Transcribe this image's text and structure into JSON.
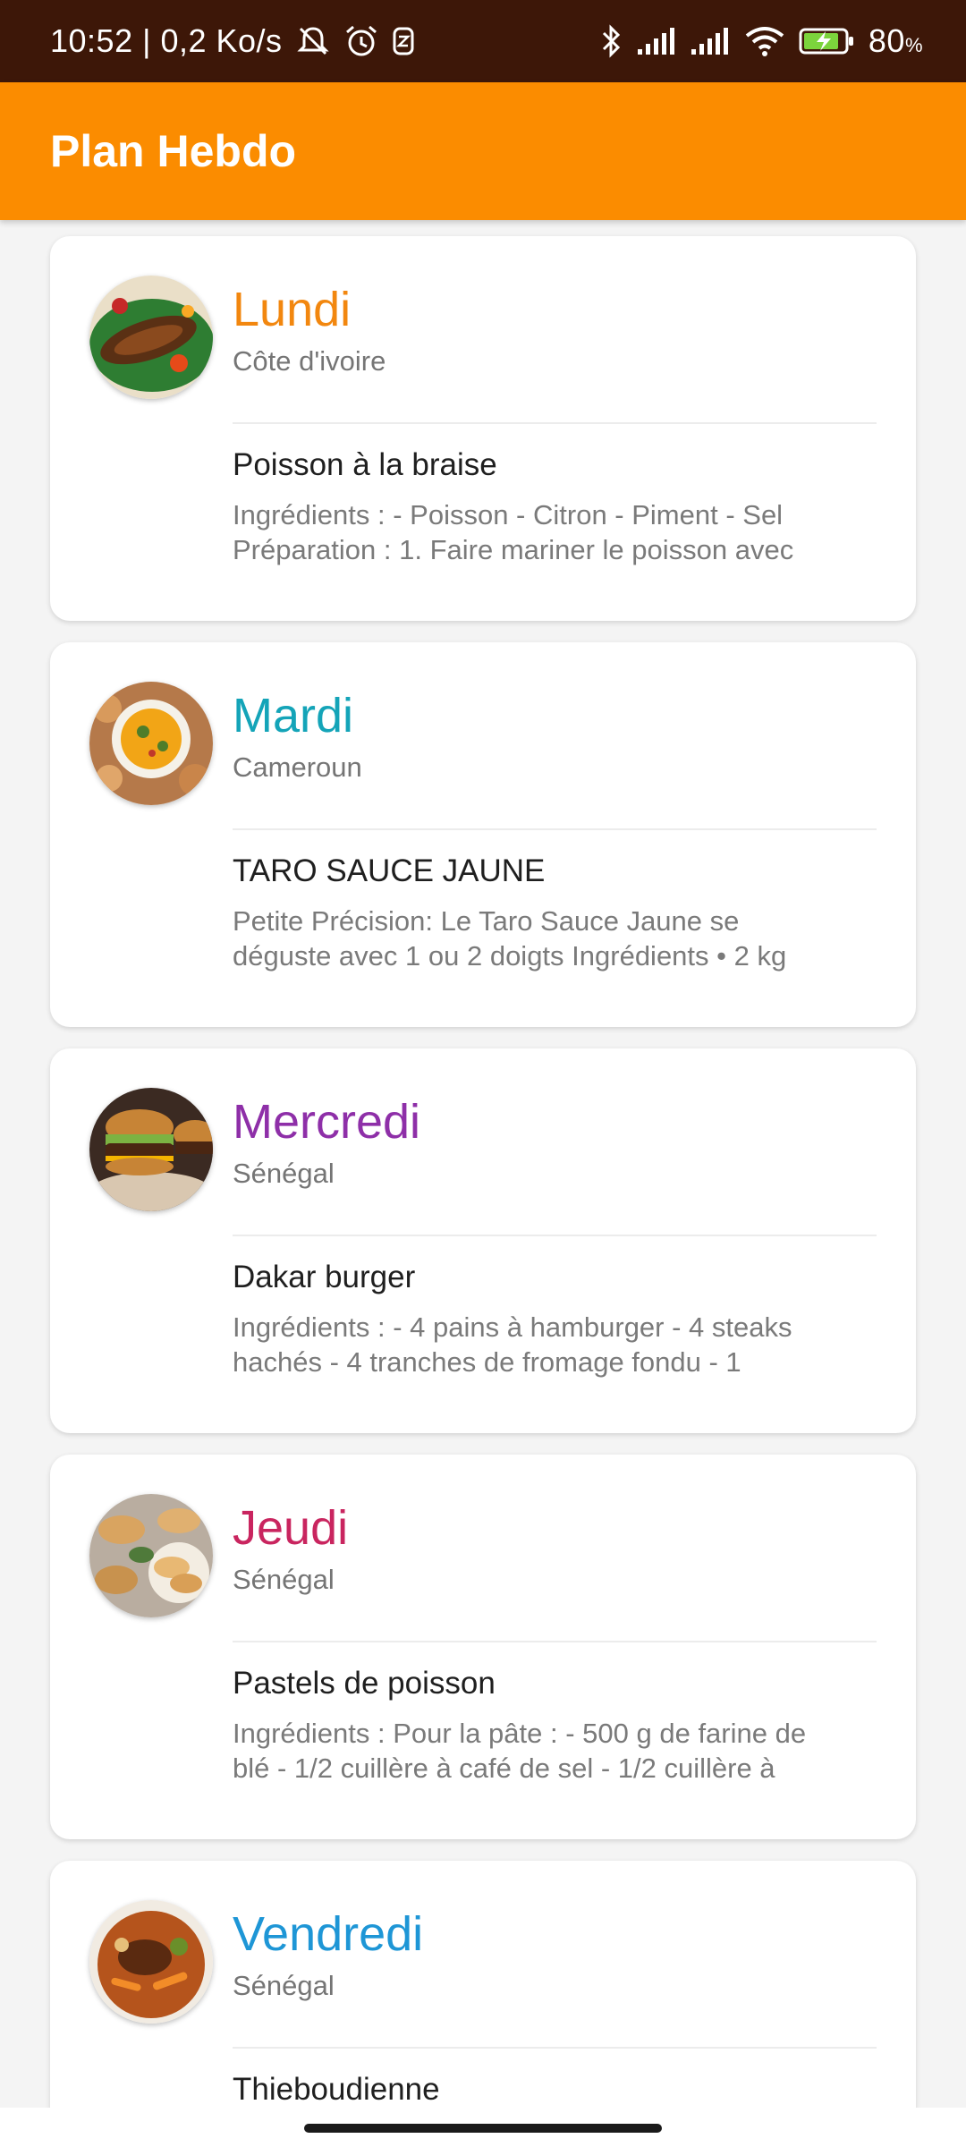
{
  "status_bar": {
    "time_speed": "10:52 | 0,2 Ko/s",
    "battery": "80",
    "battery_unit": "%",
    "icons": [
      "muted-notifications-icon",
      "alarm-icon",
      "app-notification-icon",
      "bluetooth-icon",
      "signal-icon",
      "signal-icon",
      "wifi-icon",
      "battery-charging-icon"
    ]
  },
  "app_bar": {
    "title": "Plan Hebdo",
    "color": "#fb8c00"
  },
  "days": [
    {
      "day": "Lundi",
      "day_color": "#f2870f",
      "country": "Côte d'ivoire",
      "dish": "Poisson à la braise",
      "desc_lines": [
        "Ingrédients : - Poisson - Citron - Piment - Sel",
        "Préparation : 1. Faire mariner le poisson avec"
      ],
      "image": "grilled-fish-image"
    },
    {
      "day": "Mardi",
      "day_color": "#14a4b8",
      "country": "Cameroun",
      "dish": "TARO SAUCE JAUNE",
      "desc_lines": [
        "Petite Précision: Le Taro Sauce Jaune se",
        "déguste avec 1 ou 2 doigts  Ingrédients   • 2 kg"
      ],
      "image": "taro-yellow-sauce-image"
    },
    {
      "day": "Mercredi",
      "day_color": "#8e2fa8",
      "country": "Sénégal",
      "dish": "Dakar burger",
      "desc_lines": [
        "Ingrédients : - 4 pains à hamburger - 4 steaks",
        "hachés - 4 tranches de fromage fondu - 1"
      ],
      "image": "burger-image"
    },
    {
      "day": "Jeudi",
      "day_color": "#c9255f",
      "country": "Sénégal",
      "dish": "Pastels de poisson",
      "desc_lines": [
        "Ingrédients : Pour la pâte : - 500 g de farine de",
        "blé - 1/2 cuillère à café de sel - 1/2 cuillère à"
      ],
      "image": "fish-pastels-image"
    },
    {
      "day": "Vendredi",
      "day_color": "#1e96d6",
      "country": "Sénégal",
      "dish": "Thieboudienne",
      "desc_lines": [
        "",
        ""
      ],
      "image": "thieboudienne-image"
    }
  ]
}
